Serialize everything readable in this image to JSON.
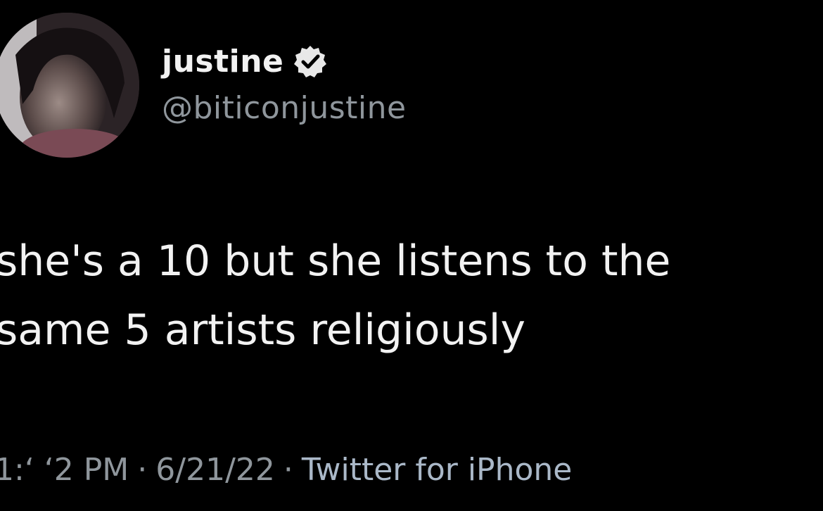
{
  "tweet": {
    "author": {
      "display_name": "justine",
      "handle": "@biticonjustine",
      "verified": true,
      "verified_icon": "verified-check-icon"
    },
    "text": "she's a 10 but she listens to the\nsame 5 artists religiously",
    "meta": {
      "time": "1:‘ ‘2 PM",
      "separator": "·",
      "date": "6/21/22",
      "source": "Twitter for iPhone"
    }
  },
  "colors": {
    "background": "#000000",
    "primary_text": "#f2f2f2",
    "secondary_text": "#8f969c",
    "source_link": "#aab8c8",
    "badge": "#e8e8e8"
  }
}
